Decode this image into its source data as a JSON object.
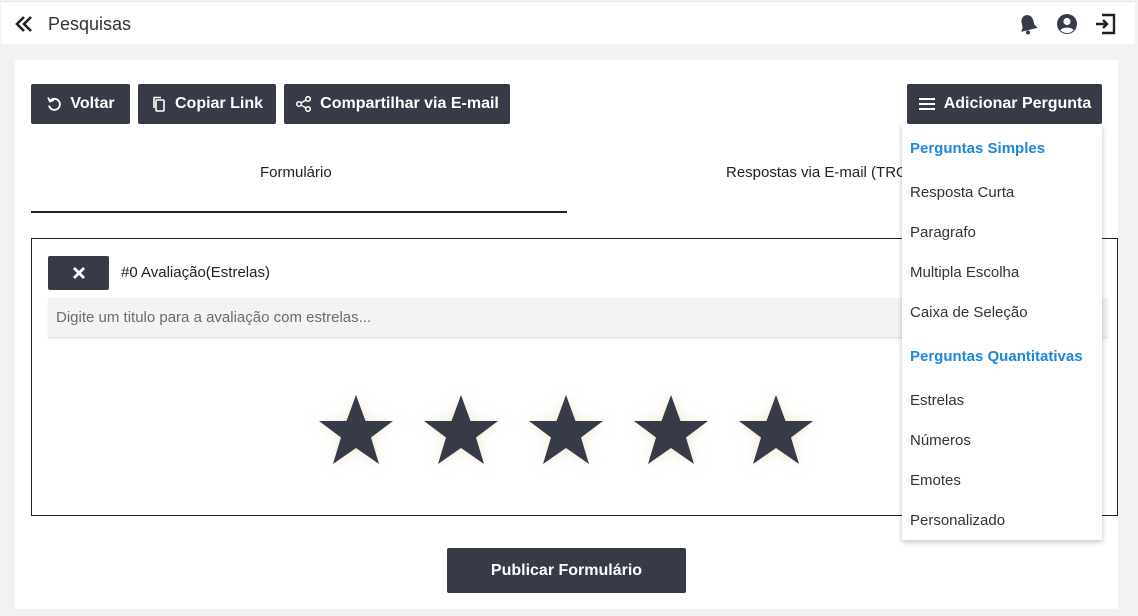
{
  "header": {
    "title": "Pesquisas"
  },
  "toolbar": {
    "back_label": "Voltar",
    "copy_link_label": "Copiar Link",
    "share_email_label": "Compartilhar via E-mail",
    "add_question_label": "Adicionar Pergunta"
  },
  "tabs": [
    {
      "label": "Formulário",
      "active": true
    },
    {
      "label": "Respostas via E-mail (TRO"
    }
  ],
  "question": {
    "remove_icon": "close-icon",
    "label": "#0 Avaliação(Estrelas)",
    "title_placeholder": "Digite um titulo para a avaliação com estrelas...",
    "stars_count": 5
  },
  "publish_label": "Publicar Formulário",
  "dropdown": {
    "simple_header": "Perguntas Simples",
    "simple_items": [
      "Resposta Curta",
      "Paragrafo",
      "Multipla Escolha",
      "Caixa de Seleção"
    ],
    "quantitative_header": "Perguntas Quantitativas",
    "quantitative_items": [
      "Estrelas",
      "Números",
      "Emotes",
      "Personalizado"
    ]
  },
  "icons": {
    "back": "double-chevron-left-icon",
    "bell": "bell-icon",
    "user": "user-circle-icon",
    "logout": "logout-icon"
  },
  "colors": {
    "dark_button": "#373a47",
    "accent": "#1e88d8",
    "star": "#373a47"
  }
}
